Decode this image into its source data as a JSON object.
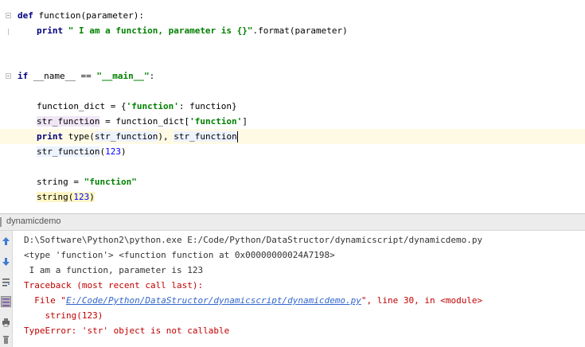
{
  "editor": {
    "lines": {
      "l1": {
        "kw": "def",
        "rest": " function(parameter):"
      },
      "l2": {
        "kw": "print",
        "str": "\" I am a function, parameter is {}\"",
        "rest": ".format(parameter)"
      },
      "l3": {
        "kw": "if",
        "a": " __name__ == ",
        "str": "\"__main__\"",
        "b": ":"
      },
      "l4": {
        "a": "function_dict = {",
        "str": "'function'",
        "b": ": function}"
      },
      "l5": {
        "a": "str_function",
        "b": " = function_dict[",
        "str": "'function'",
        "c": "]"
      },
      "l6": {
        "kw": "print",
        "a": " type(",
        "b": "str_function",
        "c": "), ",
        "d": "str_function"
      },
      "l7": {
        "a": "str_function",
        "b": "(",
        "num": "123",
        "c": ")"
      },
      "l8": {
        "a": "string = ",
        "str": "\"function\""
      },
      "l9": {
        "a": "string",
        "b": "(",
        "num": "123",
        "c": ")"
      }
    }
  },
  "run_panel": {
    "title": "dynamicdemo",
    "icons": [
      "arrow-up-icon",
      "arrow-down-icon",
      "soft-wrap-icon",
      "scroll-to-end-icon",
      "print-icon",
      "trash-icon"
    ],
    "output": {
      "cmd": "D:\\Software\\Python2\\python.exe E:/Code/Python/DataStructor/dynamicscript/dynamicdemo.py",
      "type_line": "<type 'function'> <function function at 0x00000000024A7198>",
      "func_line": " I am a function, parameter is 123",
      "traceback": "Traceback (most recent call last):",
      "file_prefix": "  File \"",
      "file_link": "E:/Code/Python/DataStructor/dynamicscript/dynamicdemo.py",
      "file_suffix": "\", line 30, in <module>",
      "code_line": "    string(123)",
      "error": "TypeError: 'str' object is not callable"
    }
  }
}
